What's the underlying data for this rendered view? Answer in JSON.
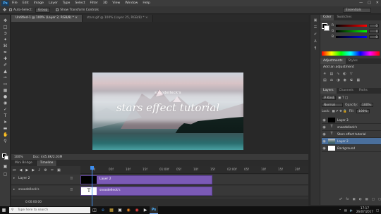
{
  "app": {
    "logo": "Ps"
  },
  "menu": [
    "File",
    "Edit",
    "Image",
    "Layer",
    "Type",
    "Select",
    "Filter",
    "3D",
    "View",
    "Window",
    "Help"
  ],
  "options_bar": {
    "auto_select": "Auto-Select:",
    "auto_select_value": "Group",
    "show_transform": "Show Transform Controls",
    "workspace": "Essentials"
  },
  "tabs": [
    {
      "label": "Untitled-1 @ 100% (Layer 2, RGB/8) *",
      "active": true
    },
    {
      "label": "stars.gif @ 100% (Layer 25, RGB/8) *",
      "active": false
    }
  ],
  "document": {
    "small_text": "snoodelleck's",
    "title": "stars effect tutorial"
  },
  "status": {
    "zoom": "100%",
    "doc": "Doc: 445.8K/2.03M"
  },
  "timeline": {
    "tabs": [
      "Mini Bridge",
      "Timeline"
    ],
    "ticks": [
      "00",
      "05f",
      "10f",
      "15f",
      "01:00f",
      "05f",
      "10f",
      "15f",
      "02:00f",
      "05f",
      "10f",
      "15f",
      "20f"
    ],
    "time_display": "0:00:00:00",
    "rows": [
      {
        "label": "Layer 2",
        "clip": "Layer 2",
        "thumb": ""
      },
      {
        "label": "snoodelleck's",
        "clip": "snoodelleck's",
        "thumb": "T"
      }
    ]
  },
  "panels": {
    "color_tabs": [
      "Color",
      "Swatches"
    ],
    "rgb": [
      {
        "label": "R",
        "value": "0"
      },
      {
        "label": "G",
        "value": "0"
      },
      {
        "label": "B",
        "value": "0"
      }
    ],
    "adj_tabs": [
      "Adjustments",
      "Styles"
    ],
    "adj_title": "Add an adjustment",
    "layers_tabs": [
      "Layers",
      "Channels",
      "Paths"
    ],
    "kind": "Kind",
    "blend": "Normal",
    "opacity_label": "Opacity:",
    "opacity": "100%",
    "lock_label": "Lock:",
    "fill_label": "Fill:",
    "fill": "100%",
    "layers": [
      {
        "name": "Layer 3",
        "selected": false,
        "thumb": "black"
      },
      {
        "name": "snoodelleck's",
        "selected": false,
        "thumb": "T"
      },
      {
        "name": "Stars effect tutorial",
        "selected": false,
        "thumb": "T"
      },
      {
        "name": "Layer 2",
        "selected": true,
        "thumb": "image"
      },
      {
        "name": "Background",
        "selected": false,
        "thumb": "white"
      }
    ]
  },
  "taskbar": {
    "search_placeholder": "Type here to search",
    "time": "17:17",
    "date": "26/07/2017"
  },
  "colors": {
    "accent": "#3d8ef0",
    "clip": "#7b5ab6",
    "layer_selected": "#4a6f9c"
  }
}
